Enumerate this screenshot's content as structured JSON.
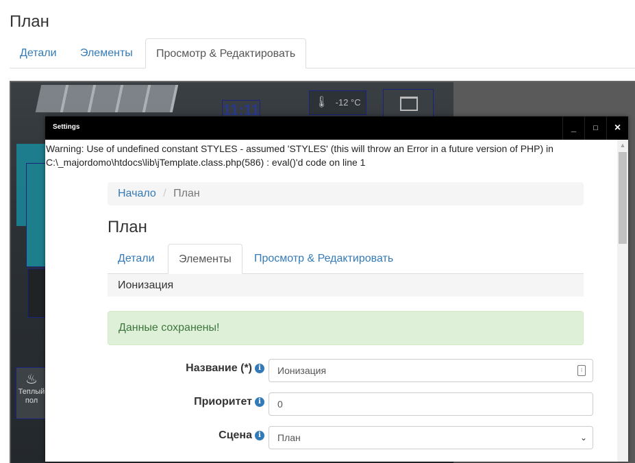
{
  "page": {
    "title": "План",
    "tabs": [
      {
        "label": "Детали"
      },
      {
        "label": "Элементы"
      },
      {
        "label": "Просмотр & Редактировать"
      }
    ]
  },
  "scene": {
    "clock": "11:11",
    "temperature": "-12 °C",
    "heating_label": "Теплый пол"
  },
  "modal": {
    "title": "Settings",
    "window_buttons": {
      "minimize": "_",
      "maximize": "□",
      "close": "×"
    },
    "warning": "Warning: Use of undefined constant STYLES - assumed 'STYLES' (this will throw an Error in a future version of PHP) in C:\\_majordomo\\htdocs\\lib\\jTemplate.class.php(586) : eval()'d code on line 1",
    "breadcrumb": {
      "home": "Начало",
      "separator": "/",
      "current": "План"
    },
    "title_inner": "План",
    "tabs": [
      {
        "label": "Детали"
      },
      {
        "label": "Элементы"
      },
      {
        "label": "Просмотр & Редактировать"
      }
    ],
    "panel_heading": "Ионизация",
    "alert": "Данные сохранены!",
    "form": {
      "name_label": "Название (*)",
      "name_value": "Ионизация",
      "priority_label": "Приоритет",
      "priority_value": "0",
      "scene_label": "Сцена",
      "scene_value": "План"
    }
  },
  "colors": {
    "link": "#337ab7",
    "alert_bg": "#dff0d8",
    "alert_text": "#3c763d",
    "header_bg": "#000000"
  }
}
